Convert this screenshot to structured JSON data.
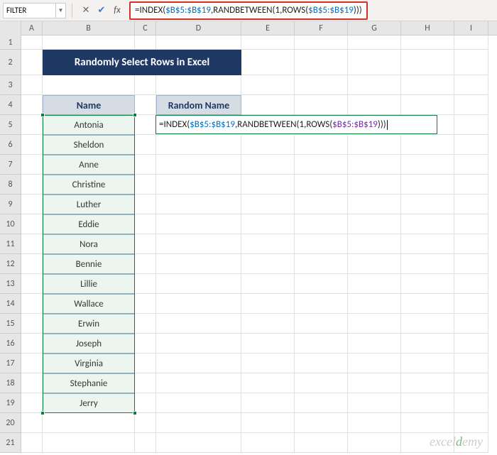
{
  "nameBox": "FILTER",
  "formula": {
    "prefix": "=INDEX(",
    "range1": "$B$5:$B$19",
    "mid1": ",RANDBETWEEN(1,ROWS(",
    "range2": "$B$5:$B$19",
    "suffix": ")))"
  },
  "columns": [
    "A",
    "B",
    "C",
    "D",
    "E",
    "F",
    "G",
    "H",
    "I"
  ],
  "rowNums": [
    "1",
    "2",
    "3",
    "4",
    "5",
    "6",
    "7",
    "8",
    "9",
    "10",
    "11",
    "12",
    "13",
    "14",
    "15",
    "16",
    "17",
    "18",
    "19"
  ],
  "title": "Randomly Select Rows in Excel",
  "headerName": "Name",
  "headerRandom": "Random Name",
  "names": [
    "Antonia",
    "Sheldon",
    "Anne",
    "Christine",
    "Luther",
    "Eddie",
    "Nora",
    "Bennie",
    "Lillie",
    "Wallace",
    "Erwin",
    "Joseph",
    "Virginia",
    "Stephanie",
    "Jerry"
  ],
  "watermark": {
    "p1": "excel",
    "p2": "d",
    "p3": "emy"
  }
}
